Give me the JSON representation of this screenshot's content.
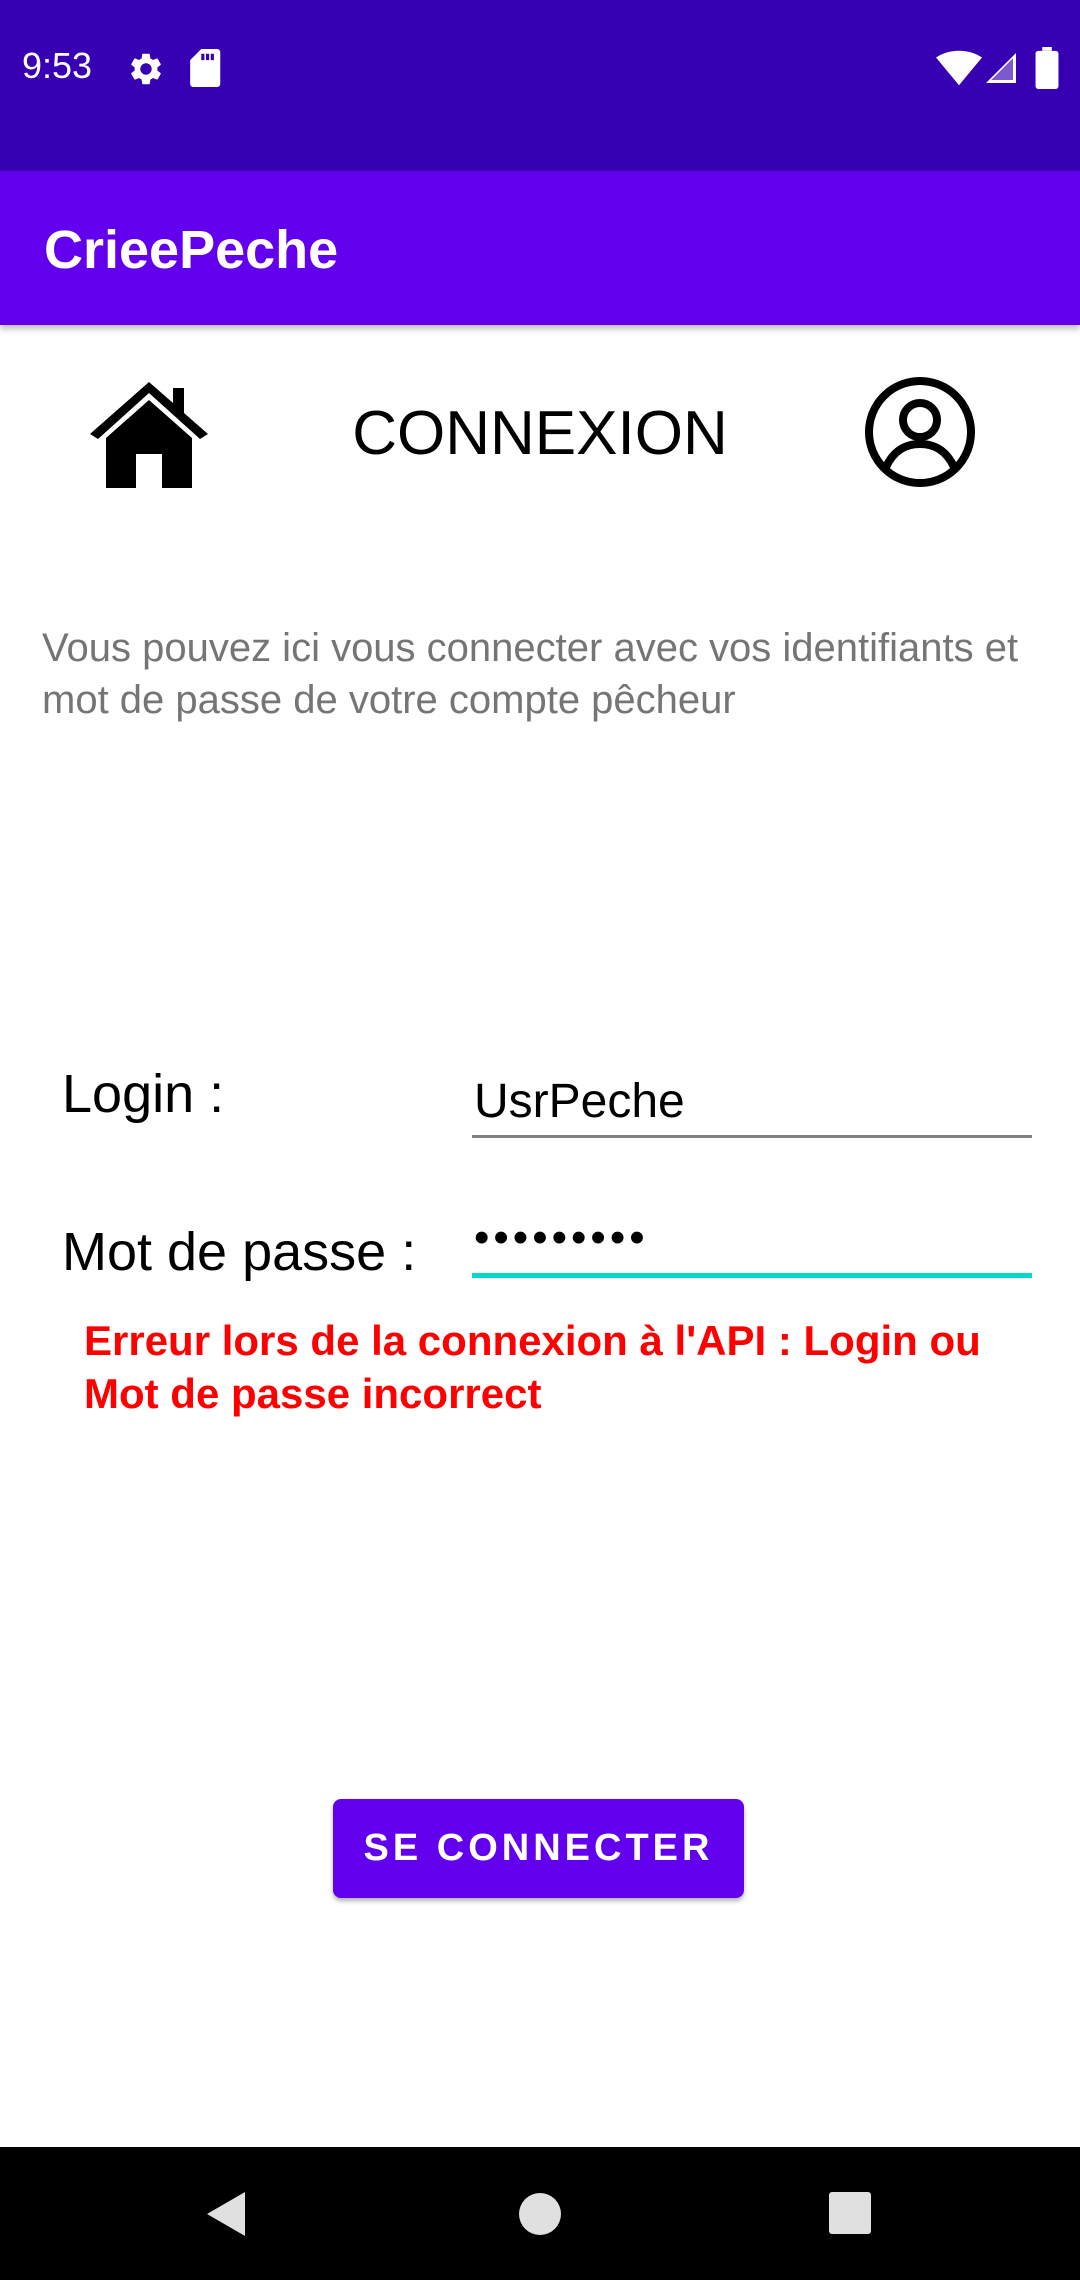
{
  "status_bar": {
    "time": "9:53",
    "icons": [
      "gear-icon",
      "sd-card-icon",
      "wifi-icon",
      "signal-icon",
      "battery-icon"
    ]
  },
  "app_bar": {
    "title": "CrieePeche"
  },
  "header": {
    "home_icon": "home-icon",
    "title": "CONNEXION",
    "account_icon": "account-circle-icon"
  },
  "intro_text": "Vous pouvez ici vous connecter avec vos identifiants et mot de passe de votre compte pêcheur",
  "form": {
    "login_label": "Login :",
    "login_value": "UsrPeche",
    "password_label": "Mot de passe :",
    "password_value": "•••••••••",
    "error_message": "Erreur lors de la connexion à l'API : Login ou Mot de passe incorrect",
    "submit_label": "SE CONNECTER"
  },
  "colors": {
    "status_bar": "#3700b3",
    "primary": "#6200ee",
    "accent": "#03dac5",
    "error": "#ff0000",
    "secondary_text": "#757575"
  },
  "nav_bar": {
    "buttons": [
      "back-icon",
      "home-circle-icon",
      "recents-icon"
    ]
  }
}
